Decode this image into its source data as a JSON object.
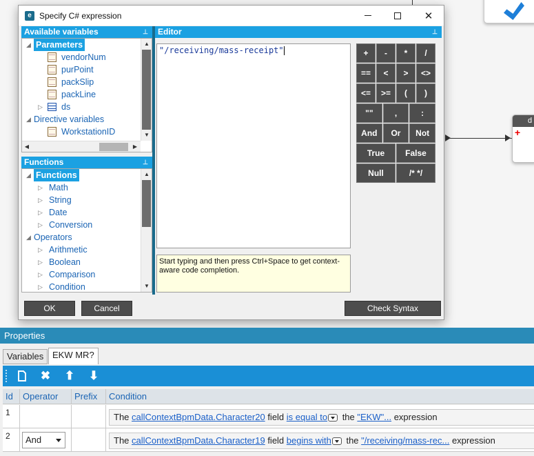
{
  "dialog": {
    "title": "Specify C# expression",
    "app_icon_letter": "e"
  },
  "variables_panel": {
    "header": "Available variables",
    "tree": [
      {
        "label": "Parameters",
        "level": 0,
        "expanded": true,
        "selected": true
      },
      {
        "label": "vendorNum",
        "level": 1,
        "icon": "variable-icon"
      },
      {
        "label": "purPoint",
        "level": 1,
        "icon": "variable-icon"
      },
      {
        "label": "packSlip",
        "level": 1,
        "icon": "variable-icon"
      },
      {
        "label": "packLine",
        "level": 1,
        "icon": "variable-icon"
      },
      {
        "label": "ds",
        "level": 1,
        "icon": "table-icon",
        "collapsed": true
      },
      {
        "label": "Directive variables",
        "level": 0,
        "expanded": true
      },
      {
        "label": "WorkstationID",
        "level": 1,
        "icon": "variable-icon"
      }
    ]
  },
  "functions_panel": {
    "header": "Functions",
    "tree": [
      {
        "label": "Functions",
        "level": 0,
        "expanded": true,
        "selected": true
      },
      {
        "label": "Math",
        "level": 1
      },
      {
        "label": "String",
        "level": 1
      },
      {
        "label": "Date",
        "level": 1
      },
      {
        "label": "Conversion",
        "level": 1
      },
      {
        "label": "Operators",
        "level": 0,
        "expanded": true
      },
      {
        "label": "Arithmetic",
        "level": 1
      },
      {
        "label": "Boolean",
        "level": 1
      },
      {
        "label": "Comparison",
        "level": 1
      },
      {
        "label": "Condition",
        "level": 1
      }
    ]
  },
  "editor": {
    "header": "Editor",
    "value": "\"/receiving/mass-receipt\"",
    "hint": "Start typing and then press Ctrl+Space to get context-aware code completion."
  },
  "operators": [
    [
      "+",
      "-",
      "*",
      "/"
    ],
    [
      "==",
      "<",
      ">",
      "<>"
    ],
    [
      "<=",
      ">=",
      "(",
      ")"
    ],
    [
      "\"\"",
      ",",
      ":"
    ],
    [
      "And",
      "Or",
      "Not"
    ],
    [
      "True",
      "False"
    ],
    [
      "Null",
      "/* */"
    ]
  ],
  "buttons": {
    "ok": "OK",
    "cancel": "Cancel",
    "check_syntax": "Check Syntax"
  },
  "properties": {
    "header": "Properties",
    "tabs": [
      "Variables",
      "EKW MR?"
    ],
    "active_tab": 1,
    "toolbar": [
      "new-icon",
      "delete-icon",
      "move-up-icon",
      "move-down-icon"
    ],
    "columns": [
      "Id",
      "Operator",
      "Prefix",
      "Condition"
    ],
    "rows": [
      {
        "id": "1",
        "operator": "",
        "prefix": "",
        "condition": {
          "the": "The",
          "field_link": "callContextBpmData.Character20",
          "field_word": "field",
          "op_link": "is equal to",
          "the2": "the",
          "value_link": "\"EKW\"...",
          "tail": "expression"
        }
      },
      {
        "id": "2",
        "operator": "And",
        "prefix": "",
        "condition": {
          "the": "The",
          "field_link": "callContextBpmData.Character19",
          "field_word": "field",
          "op_link": "begins with",
          "the2": "the",
          "value_link": "\"/receiving/mass-rec...",
          "tail": "expression"
        }
      }
    ]
  },
  "canvas": {
    "node_label": "d"
  },
  "colors": {
    "accent": "#1ba1e2",
    "dark_button": "#4d4d4d",
    "link": "#1a5fc8",
    "props_header": "#2a8bb8"
  }
}
